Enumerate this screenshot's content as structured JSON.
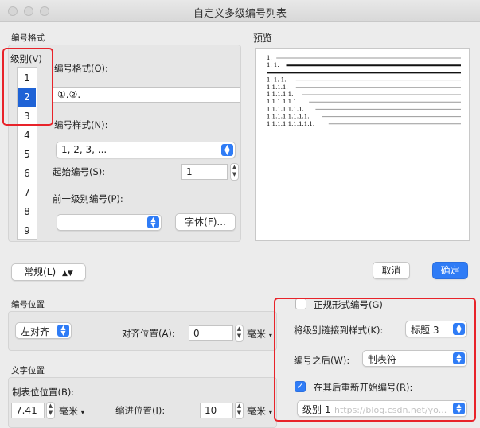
{
  "window": {
    "title": "自定义多级编号列表"
  },
  "numbering_format": {
    "section_label": "编号格式",
    "level_label": "级别(V)",
    "levels": [
      "1",
      "2",
      "3",
      "4",
      "5",
      "6",
      "7",
      "8",
      "9"
    ],
    "selected_level": "2",
    "format_label": "编号格式(O):",
    "format_value": "①.②.",
    "style_label": "编号样式(N):",
    "style_value": "1, 2, 3, ...",
    "start_label": "起始编号(S):",
    "start_value": "1",
    "prev_level_label": "前一级别编号(P):",
    "prev_level_value": "",
    "font_button": "字体(F)..."
  },
  "preview": {
    "label": "预览",
    "lines": [
      "1.",
      "1. 1.",
      "",
      "1. 1. 1.",
      "1.1.1.1.",
      "1.1.1.1.1.",
      "1.1.1.1.1.1.",
      "1.1.1.1.1.1.1.",
      "1.1.1.1.1.1.1.1.",
      "1.1.1.1.1.1.1.1.1."
    ]
  },
  "buttons": {
    "general": "常规(L)",
    "cancel": "取消",
    "ok": "确定"
  },
  "number_position": {
    "section_label": "编号位置",
    "align_value": "左对齐",
    "align_pos_label": "对齐位置(A):",
    "align_pos_value": "0",
    "unit": "毫米"
  },
  "text_position": {
    "section_label": "文字位置",
    "tab_label": "制表位位置(B):",
    "tab_value": "7.41",
    "indent_label": "缩进位置(I):",
    "indent_value": "10",
    "unit": "毫米"
  },
  "right_options": {
    "legal_label": "正规形式编号(G)",
    "link_label": "将级别链接到样式(K):",
    "link_value": "标题 3",
    "after_label": "编号之后(W):",
    "after_value": "制表符",
    "restart_label": "在其后重新开始编号(R):",
    "restart_value": "级别 1",
    "watermark": "https://blog.csdn.net/yo..."
  },
  "colors": {
    "accent": "#2f7cf6",
    "highlight": "#e8232a"
  }
}
